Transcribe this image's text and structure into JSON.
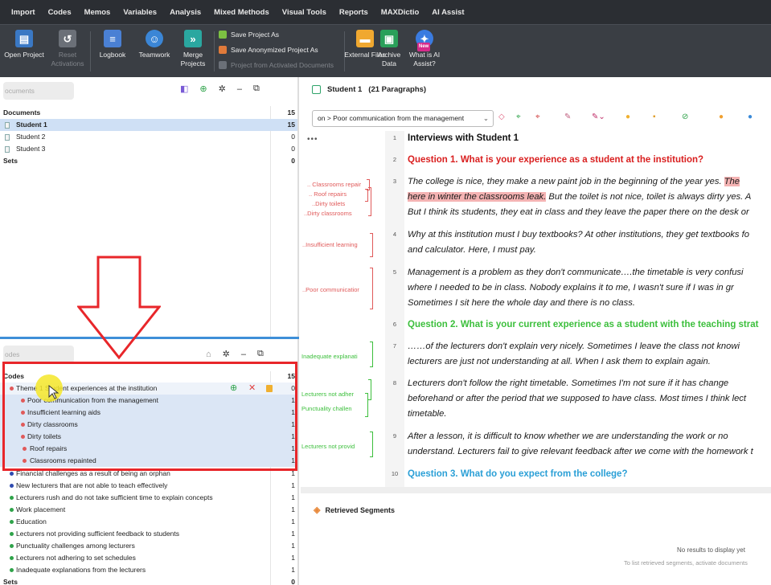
{
  "menu": [
    "Import",
    "Codes",
    "Memos",
    "Variables",
    "Analysis",
    "Mixed Methods",
    "Visual Tools",
    "Reports",
    "MAXDictio",
    "AI Assist"
  ],
  "ribbon": {
    "open_project": "Open Project",
    "reset_activations": "Reset Activations",
    "logbook": "Logbook",
    "teamwork": "Teamwork",
    "merge_projects": "Merge Projects",
    "save_project_as": "Save Project As",
    "save_anonymized": "Save Anonymized Project As",
    "project_from_activated": "Project from Activated Documents",
    "external_files": "External Files",
    "archive_data": "Archive Data",
    "ai_assist": "What is AI Assist?",
    "new_badge": "New"
  },
  "documents": {
    "search_placeholder": "ocuments",
    "header": "Documents",
    "header_count": "15",
    "items": [
      {
        "label": "Student 1",
        "count": "15"
      },
      {
        "label": "Student 2",
        "count": "0"
      },
      {
        "label": "Student 3",
        "count": "0"
      }
    ],
    "sets_label": "Sets",
    "sets_count": "0"
  },
  "codes": {
    "search_placeholder": "odes",
    "header": "Codes",
    "header_count": "15",
    "theme": {
      "label": "Theme 1 Student experiences at the institution",
      "count": "0"
    },
    "subcodes": [
      {
        "label": "Poor communication from the management",
        "count": "1"
      },
      {
        "label": "Insufficient learning aids",
        "count": "1"
      },
      {
        "label": "Dirty classrooms",
        "count": "1"
      },
      {
        "label": "Dirty toilets",
        "count": "1"
      },
      {
        "label": "Roof repairs",
        "count": "1"
      },
      {
        "label": "Classrooms repainted",
        "count": "1"
      }
    ],
    "others": [
      {
        "label": "Financial challenges as a result of being an orphan",
        "count": "1",
        "color": "#2f4bb0"
      },
      {
        "label": "New lecturers that are not able to teach effectively",
        "count": "1",
        "color": "#2f4bb0"
      },
      {
        "label": "Lecturers rush and do not take sufficient time to explain concepts",
        "count": "1",
        "color": "#2fa34a"
      },
      {
        "label": "Work placement",
        "count": "1",
        "color": "#2fa34a"
      },
      {
        "label": "Education",
        "count": "1",
        "color": "#2fa34a"
      },
      {
        "label": "Lecturers not providing sufficient feedback to students",
        "count": "1",
        "color": "#2fa34a"
      },
      {
        "label": "Punctuality challenges among lecturers",
        "count": "1",
        "color": "#2fa34a"
      },
      {
        "label": "Lecturers not adhering to set schedules",
        "count": "1",
        "color": "#2fa34a"
      },
      {
        "label": "Inadequate explanations from the lecturers",
        "count": "1",
        "color": "#2fa34a"
      }
    ],
    "sets_label": "Sets",
    "sets_count": "0"
  },
  "doc": {
    "title": "Student 1",
    "paragraph_count": "(21 Paragraphs)",
    "code_selector": "on > Poor communication from the management",
    "lines": [
      {
        "num": "1",
        "type": "heading",
        "text": "Interviews with Student 1",
        "color": "#111"
      },
      {
        "num": "2",
        "type": "question",
        "text": "Question 1. What is your experience as a student at the institution?",
        "color": "#d91e1e"
      },
      {
        "num": "3",
        "type": "para",
        "text_a": "The college is nice, they make a new paint job in the beginning of the year yes. ",
        "text_mark_a": "The",
        "text_mark_b": "here in winter the classrooms leak.",
        "text_b": " But the toilet is not nice, toilet is always dirty yes. A",
        "text_c": "But I think its students, they eat in class and they leave the paper there on the desk or"
      },
      {
        "num": "4",
        "type": "para",
        "text_a": "Why at this institution must I buy textbooks? At other institutions, they get textbooks fo",
        "text_b": "and calculator. Here, I must pay."
      },
      {
        "num": "5",
        "type": "para",
        "text_a": " Management is a problem as they don't communicate….the timetable is very confusi",
        "text_b": "where I needed to be in class. Nobody explains it to me, I wasn't sure if I was in gr",
        "text_c": "Sometimes I sit here the whole day and there is no class."
      },
      {
        "num": "6",
        "type": "question",
        "text": "Question 2. What is your current experience as a student with the teaching strat",
        "color": "#3cbf3c"
      },
      {
        "num": "7",
        "type": "para",
        "text_a": "……of the lecturers don't explain very nicely. Sometimes I leave the class not knowi",
        "text_b": "lecturers are just not understanding at all. When I ask them to explain again."
      },
      {
        "num": "8",
        "type": "para",
        "text_a": "Lecturers don't follow the right timetable. Sometimes I'm not sure if it has change",
        "text_b": "beforehand or after the period that we supposed to have class. Most times I think lect",
        "text_c": "timetable."
      },
      {
        "num": "9",
        "type": "para",
        "text_a": "After a lesson, it is difficult to know whether we are understanding the work or no",
        "text_b": "understand. Lecturers fail to give relevant feedback after we come with the homework t"
      },
      {
        "num": "10",
        "type": "question",
        "text": "Question 3. What do you expect from the college?",
        "color": "#2a9fd6"
      }
    ],
    "code_marks": {
      "classrooms_repair": ".. Classrooms repair",
      "roof_repairs": ".. Roof repairs",
      "dirty_toilets": "..Dirty toilets",
      "dirty_classrooms": "..Dirty classrooms",
      "insufficient_learning": "..Insufficient learning",
      "poor_communication": "..Poor communicatior",
      "inadequate": "Inadequate explanati",
      "lecturers_not_adher": "Lecturers not adher",
      "punctuality": "Punctuality challen",
      "lecturers_not_provid": "Lecturers not provid"
    },
    "ellipsis": "•••"
  },
  "retrieved": {
    "title": "Retrieved Segments",
    "no_results": "No results to display yet",
    "hint": "To list retrieved segments, activate documents"
  },
  "colors": {
    "red_code": "#e05a5a",
    "green_code": "#3cbf3c",
    "highlight": "#e8262a"
  }
}
